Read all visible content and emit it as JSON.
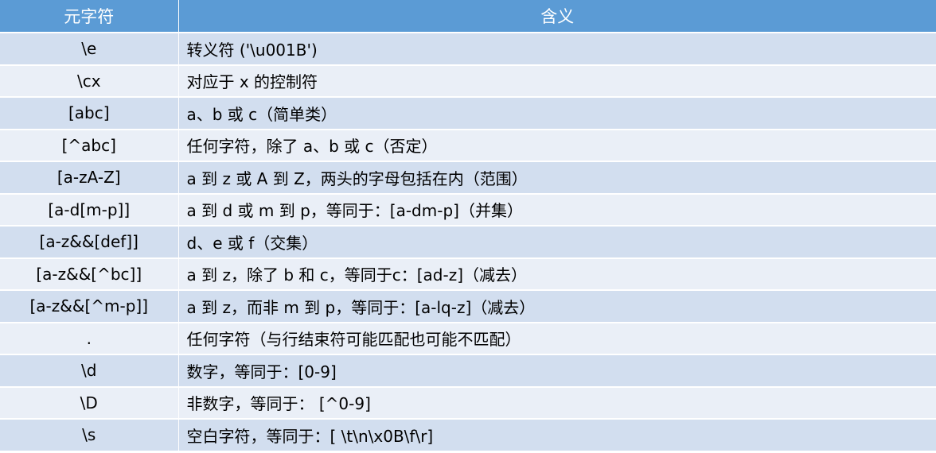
{
  "table": {
    "headers": [
      "元字符",
      "含义"
    ],
    "rows": [
      {
        "char": "\\e",
        "meaning": "转义符 ('\\u001B')"
      },
      {
        "char": "\\cx",
        "meaning": "对应于 x 的控制符"
      },
      {
        "char": "[abc]",
        "meaning": "a、b 或 c（简单类）"
      },
      {
        "char": "[^abc]",
        "meaning": "任何字符，除了 a、b 或 c（否定）"
      },
      {
        "char": "[a-zA-Z]",
        "meaning": "a 到 z 或 A 到 Z，两头的字母包括在内（范围）"
      },
      {
        "char": "[a-d[m-p]]",
        "meaning": "a 到 d 或 m 到 p，等同于：[a-dm-p]（并集）"
      },
      {
        "char": "[a-z&&[def]]",
        "meaning": "d、e 或 f（交集）"
      },
      {
        "char": "[a-z&&[^bc]]",
        "meaning": "a 到 z，除了 b 和 c，等同于c：[ad-z]（减去）"
      },
      {
        "char": "[a-z&&[^m-p]]",
        "meaning": "a 到 z，而非 m 到 p，等同于：[a-lq-z]（减去）"
      },
      {
        "char": ".",
        "meaning": "任何字符（与行结束符可能匹配也可能不匹配）"
      },
      {
        "char": "\\d",
        "meaning": "数字，等同于：[0-9]"
      },
      {
        "char": "\\D",
        "meaning": "非数字，等同于： [^0-9]"
      },
      {
        "char": "\\s",
        "meaning": "空白字符，等同于：[ \\t\\n\\x0B\\f\\r]"
      }
    ]
  },
  "colors": {
    "header_bg": "#5b9bd5",
    "row_odd_bg": "#d2deef",
    "row_even_bg": "#eaeff7"
  }
}
